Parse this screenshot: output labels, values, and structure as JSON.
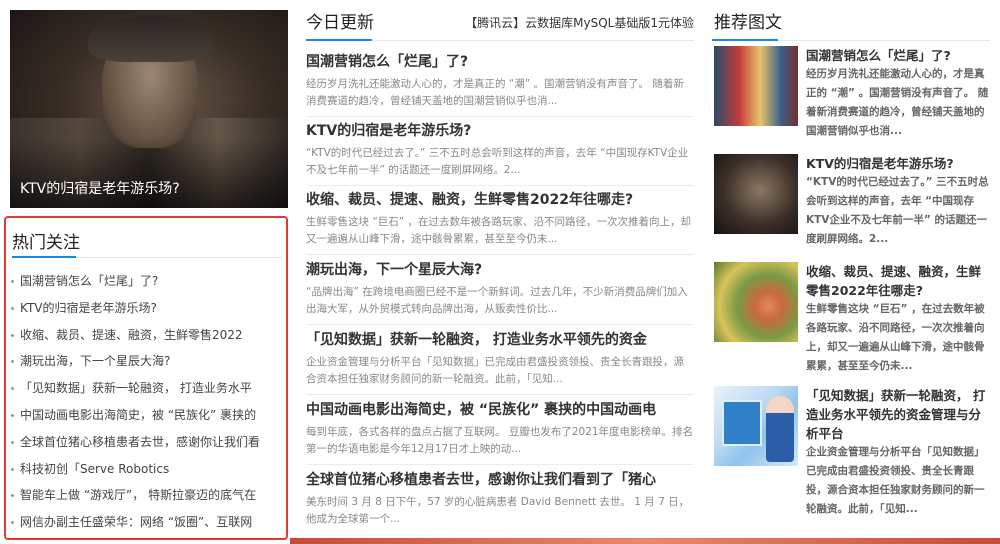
{
  "hero": {
    "caption": "KTV的归宿是老年游乐场?"
  },
  "hot": {
    "title": "热门关注",
    "items": [
      "国潮营销怎么「烂尾」了?",
      "KTV的归宿是老年游乐场?",
      "收缩、裁员、提速、融资，生鲜零售2022",
      "潮玩出海，下一个星辰大海?",
      "「见知数据」获新一轮融资， 打造业务水平",
      "中国动画电影出海简史，被 “民族化” 裹挟的",
      "全球首位猪心移植患者去世，感谢你让我们看",
      "科技初创「Serve Robotics",
      "智能车上做 “游戏厅”， 特斯拉豪迈的底气在",
      "网信办副主任盛荣华：网络 “饭圈”、互联网"
    ]
  },
  "today": {
    "title": "今日更新",
    "ad": "【腾讯云】云数据库MySQL基础版1元体验",
    "articles": [
      {
        "title": "国潮营销怎么「烂尾」了?",
        "summary": "经历岁月洗礼还能激动人心的，才是真正的 “潮” 。国潮营销没有声音了。 随着新消费赛道的趋冷，曾经铺天盖地的国潮营销似乎也消..."
      },
      {
        "title": "KTV的归宿是老年游乐场?",
        "summary": "“KTV的时代已经过去了。” 三不五时总会听到这样的声音，去年 “中国现存KTV企业不及七年前一半” 的话题还一度刷屏网络。2..."
      },
      {
        "title": "收缩、裁员、提速、融资，生鲜零售2022年往哪走?",
        "summary": "生鲜零售这块 “巨石” ，在过去数年被各路玩家、沿不同路径，一次次推着向上，却又一遍遍从山峰下滑，途中骸骨累累，甚至至今仍未..."
      },
      {
        "title": "潮玩出海，下一个星辰大海?",
        "summary": "“品牌出海” 在跨境电商圈已经不是一个新鲜词。过去几年，不少新消费品牌们加入出海大军，从外贸模式转向品牌出海，从贩卖性价比..."
      },
      {
        "title": "「见知数据」获新一轮融资， 打造业务水平领先的资金",
        "summary": "企业资金管理与分析平台「见知数据」已完成由君盛投资领投、贵全长青跟投，源合资本担任独家财务顾问的新一轮融资。此前，「见知..."
      },
      {
        "title": "中国动画电影出海简史，被 “民族化” 裹挟的中国动画电",
        "summary": "每到年底，各式各样的盘点占据了互联网。 豆瓣也发布了2021年度电影榜单。排名第一的华语电影是今年12月17日才上映的动..."
      },
      {
        "title": "全球首位猪心移植患者去世，感谢你让我们看到了「猪心",
        "summary": "美东时间 3 月 8 日下午，57 岁的心脏病患者 David Bennett 去世。 1 月 7 日，他成为全球第一个..."
      }
    ]
  },
  "recommend": {
    "title": "推荐图文",
    "items": [
      {
        "title": "国潮营销怎么「烂尾」了?",
        "summary": "经历岁月洗礼还能激动人心的，才是真正的 “潮” 。国潮营销没有声音了。 随着新消费赛道的趋冷，曾经铺天盖地的国潮营销似乎也消..."
      },
      {
        "title": "KTV的归宿是老年游乐场?",
        "summary": "“KTV的时代已经过去了。” 三不五时总会听到这样的声音，去年 “中国现存KTV企业不及七年前一半” 的话题还一度刷屏网络。2..."
      },
      {
        "title": "收缩、裁员、提速、融资，生鲜零售2022年往哪走?",
        "summary": "生鲜零售这块 “巨石” ，在过去数年被各路玩家、沿不同路径，一次次推着向上，却又一遍遍从山峰下滑，途中骸骨累累，甚至至今仍未..."
      },
      {
        "title": "「见知数据」获新一轮融资， 打造业务水平领先的资金管理与分析平台",
        "summary": "企业资金管理与分析平台「见知数据」已完成由君盛投资领投、贵全长青跟投，源合资本担任独家财务顾问的新一轮融资。此前，「见知..."
      }
    ]
  }
}
